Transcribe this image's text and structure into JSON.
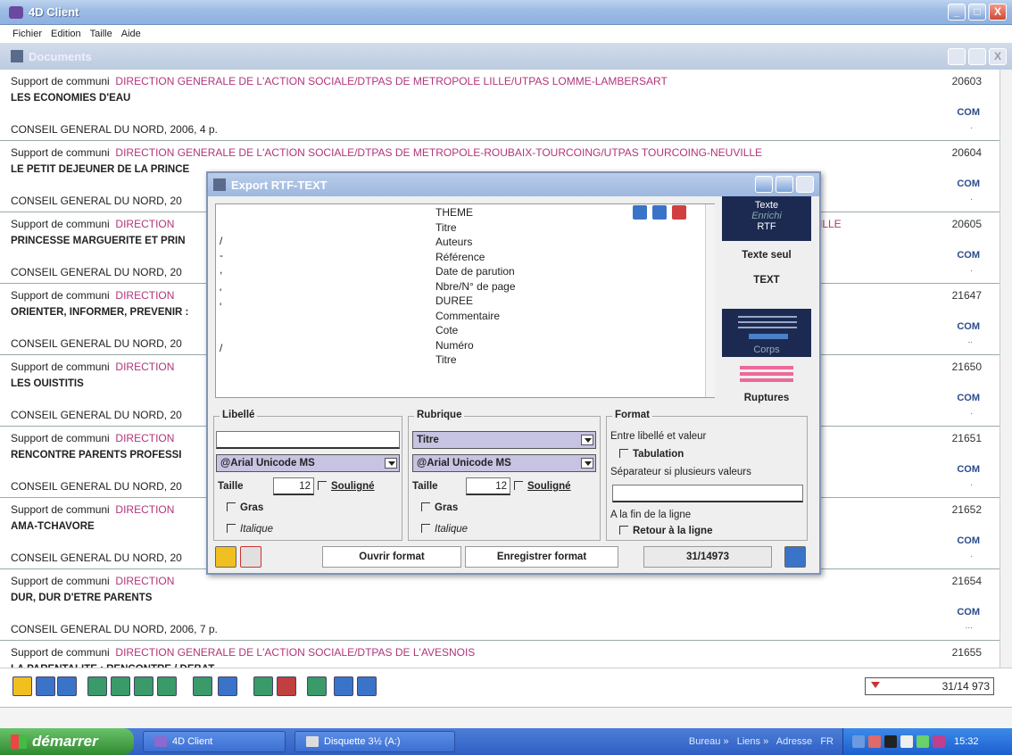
{
  "window": {
    "title": "4D Client",
    "min": "_",
    "max": "□",
    "close": "X"
  },
  "menu": [
    "Fichier",
    "Edition",
    "Taille",
    "Aide"
  ],
  "documents": {
    "title": "Documents"
  },
  "records": [
    {
      "type": "Support de communi",
      "org": "DIRECTION GENERALE DE L'ACTION SOCIALE/DTPAS DE METROPOLE LILLE/UTPAS LOMME-LAMBERSART",
      "title": "LES ECONOMIES D'EAU",
      "pub": "CONSEIL GENERAL DU NORD, 2006, 4 p.",
      "num": "20603",
      "com": "COM",
      "dot": "."
    },
    {
      "type": "Support de communi",
      "org": "DIRECTION GENERALE DE L'ACTION SOCIALE/DTPAS DE METROPOLE-ROUBAIX-TOURCOING/UTPAS TOURCOING-NEUVILLE",
      "title": "LE PETIT DEJEUNER DE LA PRINCE",
      "pub": "CONSEIL GENERAL DU NORD, 20",
      "num": "20604",
      "com": "COM",
      "dot": "."
    },
    {
      "type": "Support de communi",
      "org": "DIRECTION",
      "org_tail": "ILLE",
      "title": "PRINCESSE MARGUERITE ET PRIN",
      "pub": "CONSEIL GENERAL DU NORD, 20",
      "num": "20605",
      "com": "COM",
      "dot": "."
    },
    {
      "type": "Support de communi",
      "org": "DIRECTION",
      "title": "ORIENTER, INFORMER, PREVENIR :",
      "pub": "CONSEIL GENERAL DU NORD, 20",
      "num": "21647",
      "com": "COM",
      "dot": ".."
    },
    {
      "type": "Support de communi",
      "org": "DIRECTION",
      "title": "LES OUISTITIS",
      "pub": "CONSEIL GENERAL DU NORD, 20",
      "num": "21650",
      "com": "COM",
      "dot": "."
    },
    {
      "type": "Support de communi",
      "org": "DIRECTION",
      "title": "RENCONTRE PARENTS PROFESSI",
      "pub": "CONSEIL GENERAL DU NORD, 20",
      "num": "21651",
      "com": "COM",
      "dot": "."
    },
    {
      "type": "Support de communi",
      "org": "DIRECTION",
      "title": "AMA-TCHAVORE",
      "pub": "CONSEIL GENERAL DU NORD, 20",
      "num": "21652",
      "com": "COM",
      "dot": "."
    },
    {
      "type": "Support de communi",
      "org": "DIRECTION",
      "title": "DUR, DUR D'ETRE PARENTS",
      "pub": "CONSEIL GENERAL DU NORD, 2006, 7 p.",
      "num": "21654",
      "com": "COM",
      "dot": "..."
    },
    {
      "type": "Support de communi",
      "org": "DIRECTION GENERALE DE L'ACTION SOCIALE/DTPAS DE L'AVESNOIS",
      "title": "LA PARENTALITE : RENCONTRE / DEBAT",
      "pub": "",
      "num": "21655",
      "com": "",
      "dot": ""
    }
  ],
  "counter": "31/14 973",
  "dialog": {
    "title": "Export RTF-TEXT",
    "fields": [
      "THEME",
      "Titre",
      "Auteurs",
      "Référence",
      "Date de parution",
      "Nbre/N° de page",
      "DUREE",
      "Commentaire",
      "Cote",
      "Numéro",
      "Titre"
    ],
    "left_marks": [
      "/",
      "-",
      ",",
      "'",
      "'",
      "/"
    ],
    "side": {
      "texte": "Texte",
      "enrichi": "Enrichi",
      "rtf": "RTF",
      "texte_seul": "Texte seul",
      "text": "TEXT",
      "corps": "Corps",
      "ruptures": "Ruptures"
    },
    "libelle": {
      "title": "Libellé",
      "value": "",
      "font": "@Arial Unicode MS",
      "taille_label": "Taille",
      "taille": "12",
      "souligne": "Souligné",
      "gras": "Gras",
      "italique": "Italique"
    },
    "rubrique": {
      "title": "Rubrique",
      "field": "Titre",
      "font": "@Arial Unicode MS",
      "taille_label": "Taille",
      "taille": "12",
      "souligne": "Souligné",
      "gras": "Gras",
      "italique": "Italique"
    },
    "format": {
      "title": "Format",
      "entre": "Entre libellé et valeur",
      "tabulation": "Tabulation",
      "separateur": "Séparateur si plusieurs valeurs",
      "sep_value": "",
      "fin": "A la fin de la ligne",
      "retour": "Retour à la ligne"
    },
    "buttons": {
      "ouvrir": "Ouvrir format",
      "enregistrer": "Enregistrer format"
    },
    "counter": "31/14973"
  },
  "taskbar": {
    "start": "démarrer",
    "task1": "4D Client",
    "task2": "Disquette 3½ (A:)",
    "bureau": "Bureau",
    "liens": "Liens",
    "adresse": "Adresse",
    "lang": "FR",
    "clock": "15:32"
  }
}
